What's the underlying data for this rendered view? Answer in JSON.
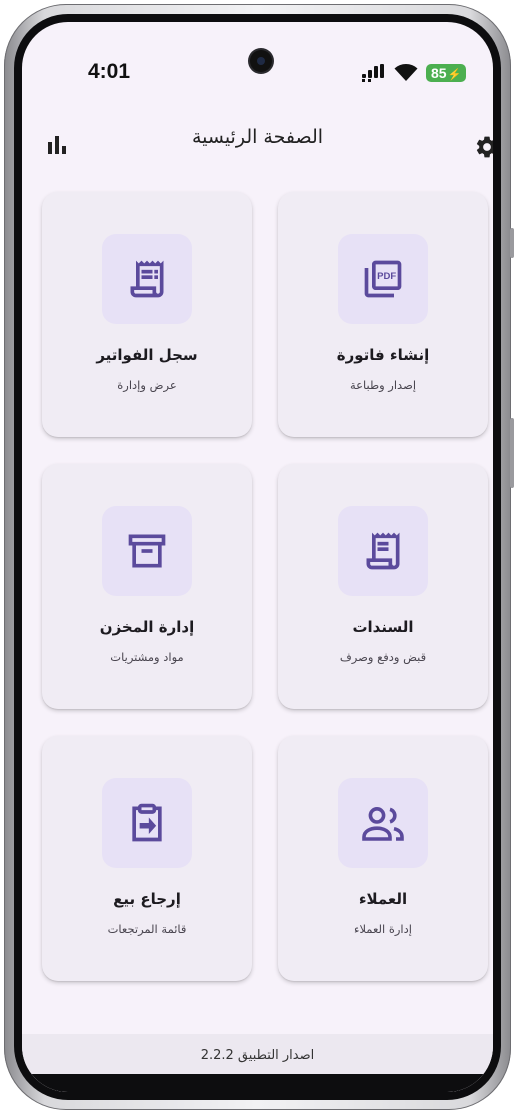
{
  "status_bar": {
    "time": "4:01",
    "battery": "85",
    "icons": [
      "signal-icon",
      "wifi-icon",
      "battery-charging-icon"
    ]
  },
  "app_bar": {
    "title": "الصفحة الرئيسية",
    "left_icon": "bar-chart-icon",
    "right_icon": "gear-icon"
  },
  "cards": [
    {
      "title": "إنشاء فاتورة",
      "subtitle": "إصدار وطباعة",
      "icon": "pdf-icon"
    },
    {
      "title": "سجل الفواتير",
      "subtitle": "عرض وإدارة",
      "icon": "receipt-long-icon"
    },
    {
      "title": "السندات",
      "subtitle": "قبض ودفع وصرف",
      "icon": "receipt-icon"
    },
    {
      "title": "إدارة المخزن",
      "subtitle": "مواد ومشتريات",
      "icon": "archive-box-icon"
    },
    {
      "title": "العملاء",
      "subtitle": "إدارة العملاء",
      "icon": "people-icon"
    },
    {
      "title": "إرجاع بيع",
      "subtitle": "قائمة المرتجعات",
      "icon": "return-icon"
    }
  ],
  "footer": {
    "version_text": "اصدار التطبيق 2.2.2"
  },
  "colors": {
    "background": "#f7f2fa",
    "card": "#f0ecf4",
    "icon_container": "#e7e1f6",
    "icon": "#5b4a9c",
    "battery": "#4caf50"
  }
}
